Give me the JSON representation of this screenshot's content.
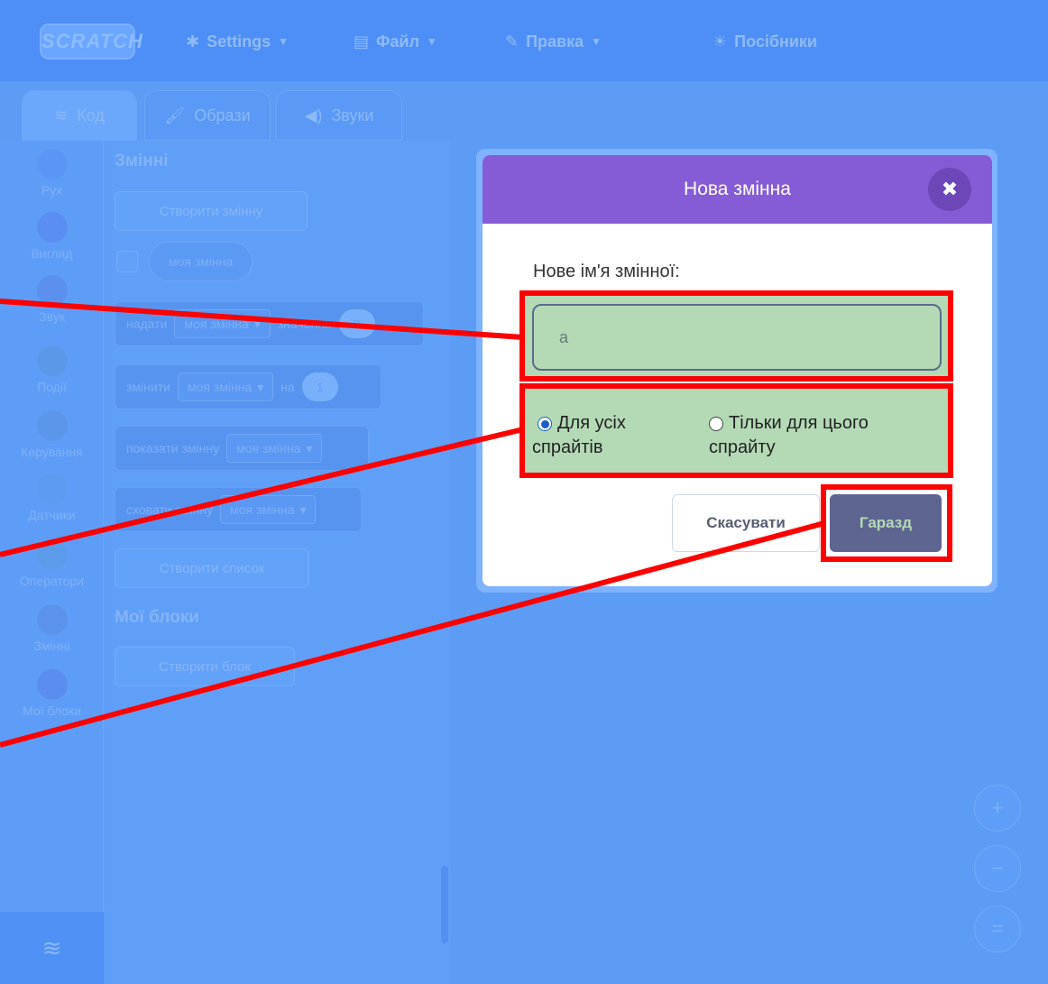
{
  "menubar": {
    "logo": "SCRATCH",
    "settings": "Settings",
    "file": "Файл",
    "edit": "Правка",
    "tutorials": "Посібники"
  },
  "tabs": {
    "code": "Код",
    "costumes": "Образи",
    "sounds": "Звуки"
  },
  "categories": [
    {
      "label": "Рух",
      "color": "#5b95f5"
    },
    {
      "label": "Вигляд",
      "color": "#5b8ef2"
    },
    {
      "label": "Звук",
      "color": "#5b90ef"
    },
    {
      "label": "Події",
      "color": "#5b99e8"
    },
    {
      "label": "Керування",
      "color": "#5b96ea"
    },
    {
      "label": "Датчики",
      "color": "#5b9bf0"
    },
    {
      "label": "Оператори",
      "color": "#5b9cea"
    },
    {
      "label": "Змінні",
      "color": "#5b93eb"
    },
    {
      "label": "Мої блоки",
      "color": "#5b8df0"
    }
  ],
  "palette": {
    "variables_title": "Змінні",
    "make_variable": "Створити змінну",
    "my_variable": "моя змінна",
    "set_block": "надати",
    "set_to": "значення",
    "set_value": "0",
    "change_block": "змінити",
    "change_by": "на",
    "change_value": "1",
    "show_block": "показати змінну",
    "hide_block": "сховати змінну",
    "make_list": "Створити список",
    "my_blocks_title": "Мої блоки",
    "make_block": "Створити блок"
  },
  "zoom": {
    "zoom_in": "+",
    "zoom_out": "−",
    "reset": "="
  },
  "dialog": {
    "title": "Нова змінна",
    "close": "✖",
    "field_label": "Нове ім'я змінної:",
    "name_value": "а",
    "radio_all": "Для усіх спрайтів",
    "radio_all_line1": "Для усіх",
    "radio_all_line2": "спрайтів",
    "radio_this_line1": "Тільки для цього",
    "radio_this_line2": "спрайту",
    "selected": "all",
    "cancel": "Скасувати",
    "ok": "Гаразд"
  },
  "colors": {
    "dialog_header": "#855cd6",
    "highlight": "#ff0000",
    "highlight_fill": "#b3d9b5",
    "ok_button": "#5f6591"
  }
}
